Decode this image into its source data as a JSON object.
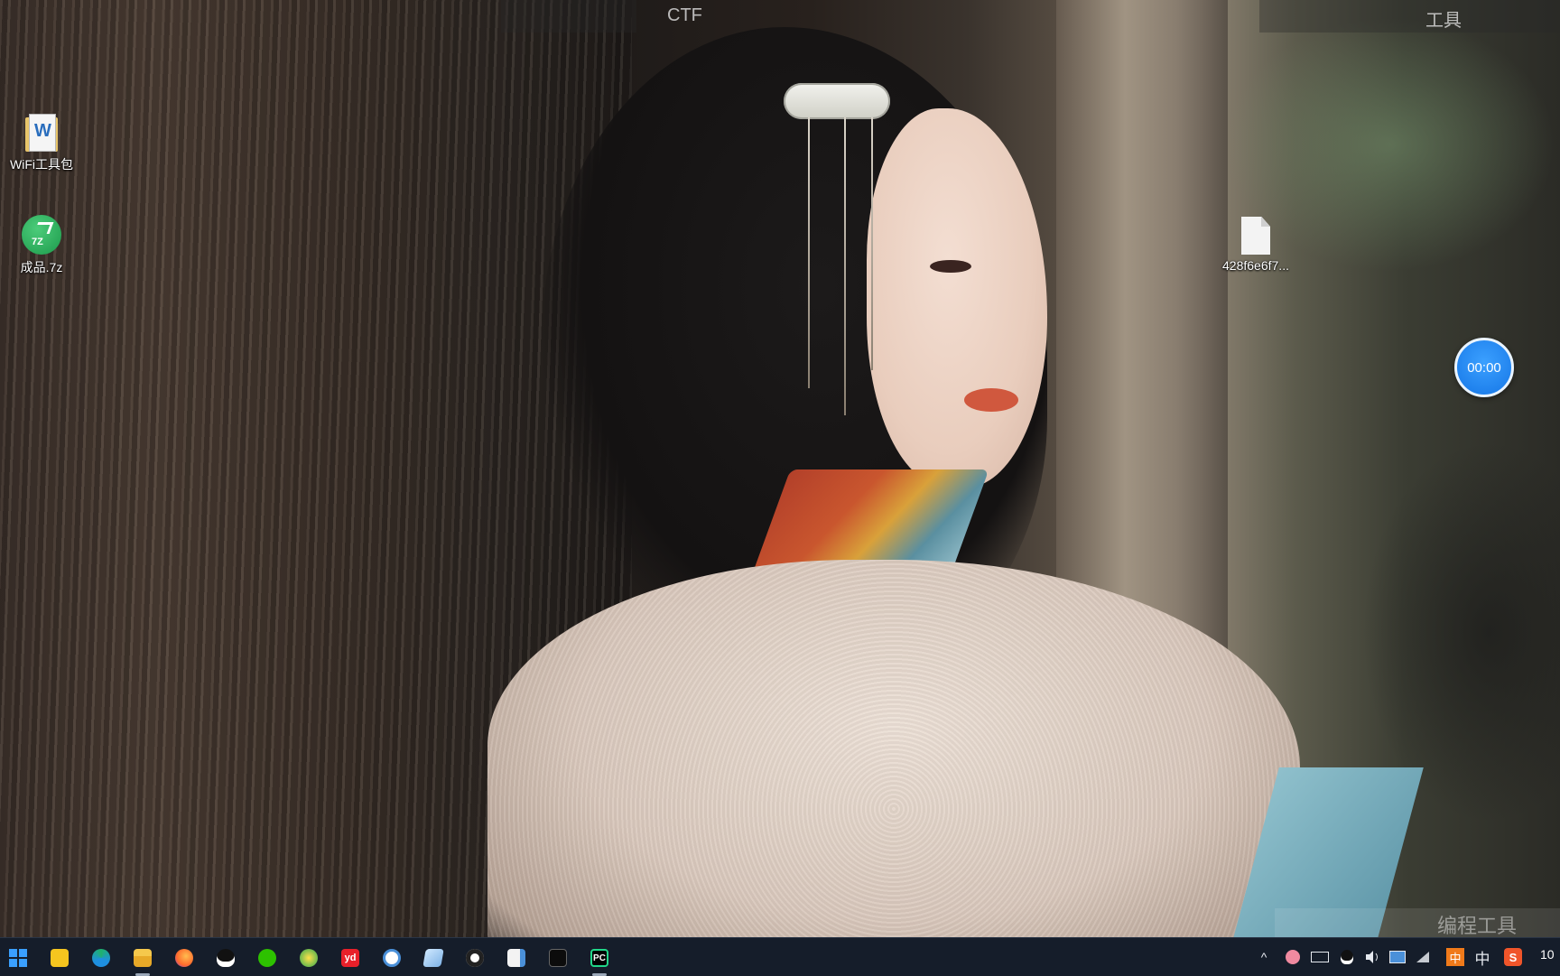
{
  "top_bar": {
    "left_label": "CTF",
    "right_label": "工具"
  },
  "desktop_icons": [
    {
      "label": "WiFi工具包",
      "icon": "folder-icon"
    },
    {
      "label": "成品.7z",
      "icon": "7z-archive-icon",
      "badge": "7Z"
    },
    {
      "label": "428f6e6f7...",
      "icon": "file-icon"
    }
  ],
  "timer": {
    "value": "00:00"
  },
  "watermark": {
    "label": "编程工具"
  },
  "taskbar": {
    "apps": [
      "start-icon",
      "sticky-notes-icon",
      "edge-icon",
      "file-explorer-icon",
      "firefox-icon",
      "qq-icon",
      "wechat-icon",
      "browser-icon",
      "youdao-icon",
      "network-icon",
      "notepad-icon",
      "app-icon",
      "file-tool-icon",
      "terminal-icon",
      "pycharm-icon"
    ],
    "pycharm_label": "PC",
    "youdao_label": "yd",
    "tray": {
      "chevron": "^",
      "ime_mode": "中",
      "ime_lang": "中",
      "sogou": "S",
      "clock": "10"
    }
  },
  "colors": {
    "taskbar_bg": "#151d2a",
    "timer_blue": "#1576e6",
    "archive_green": "#1c9a4b",
    "ime_orange": "#f07a1a"
  }
}
